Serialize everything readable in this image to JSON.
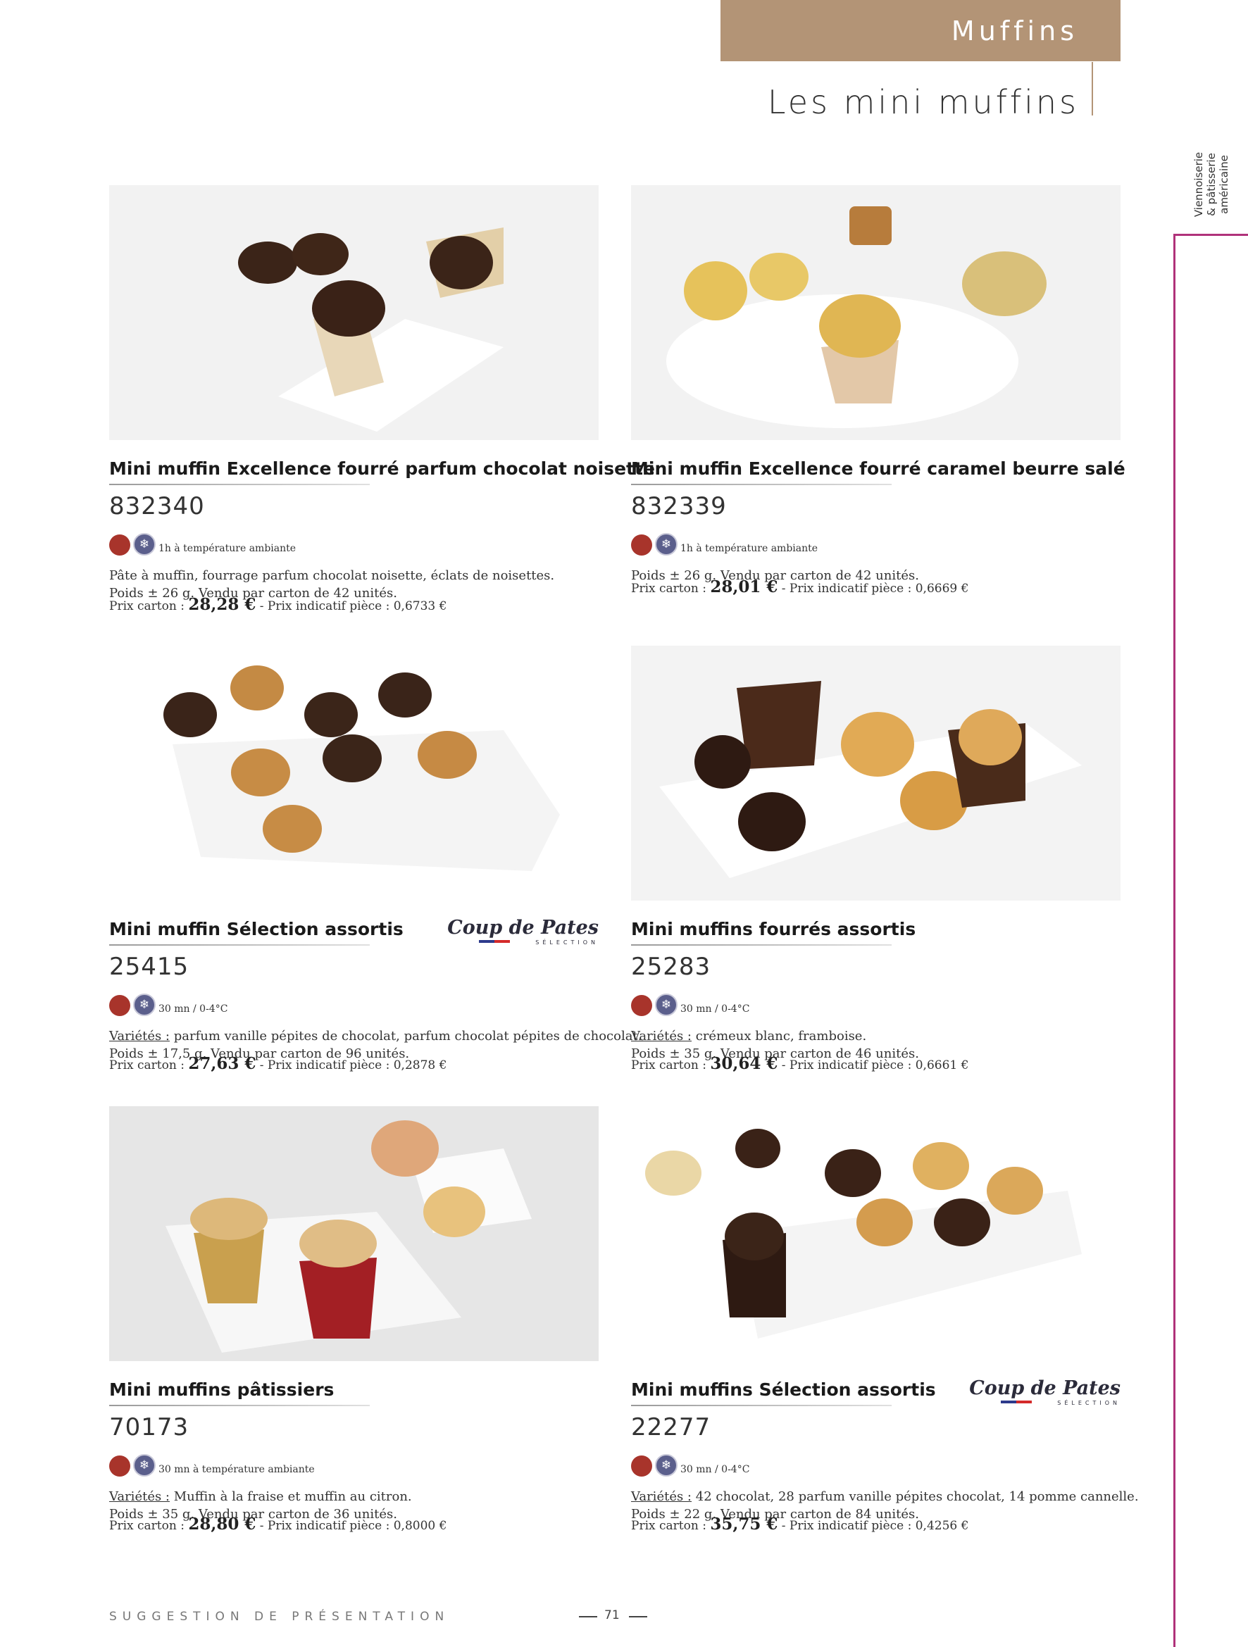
{
  "header": {
    "section": "Muffins",
    "title": "Les mini muffins"
  },
  "side_tab": {
    "line1": "Viennoiserie",
    "line2": "& pâtisserie",
    "line3": "américaine"
  },
  "icons": {
    "color_red": "#a8342b",
    "color_frozen": "#5b5f8c",
    "frozen_icon": "snowflake-icon"
  },
  "products": [
    {
      "name": "Mini muffin Excellence fourré parfum chocolat noisette",
      "code": "832340",
      "storage": "1h à température ambiante",
      "varietes_label": "",
      "desc1": "Pâte à muffin, fourrage parfum chocolat noisette, éclats de noisettes.",
      "desc2": "Poids ± 26 g. Vendu par carton de 42 unités.",
      "price_label": "Prix carton : ",
      "price": "28,28 €",
      "unit_price": " - Prix indicatif pièce : 0,6733 €"
    },
    {
      "name": "Mini muffin Excellence fourré caramel beurre salé",
      "code": "832339",
      "storage": "1h à température ambiante",
      "varietes_label": "",
      "desc1": "Poids ± 26 g. Vendu par carton de 42 unités.",
      "desc2": "",
      "price_label": "Prix carton : ",
      "price": "28,01 €",
      "unit_price": " - Prix indicatif pièce : 0,6669 €"
    },
    {
      "name": "Mini muffin Sélection assortis",
      "code": "25415",
      "storage": "30 mn / 0-4°C",
      "varietes_label": "Variétés :",
      "desc1": " parfum vanille pépites de chocolat, parfum chocolat pépites de chocolat.",
      "desc2": "Poids ± 17,5 g. Vendu par carton de 96 unités.",
      "price_label": "Prix carton : ",
      "price": "27,63 €",
      "unit_price": " - Prix indicatif pièce : 0,2878 €",
      "brand_script": "Coup de Pates",
      "brand_sub": "SÉLECTION"
    },
    {
      "name": "Mini muffins fourrés assortis",
      "code": "25283",
      "storage": "30 mn / 0-4°C",
      "varietes_label": "Variétés :",
      "desc1": " crémeux blanc, framboise.",
      "desc2": "Poids ± 35 g. Vendu par carton de 46 unités.",
      "price_label": "Prix carton : ",
      "price": "30,64 €",
      "unit_price": " - Prix indicatif pièce : 0,6661 €"
    },
    {
      "name": "Mini muffins pâtissiers",
      "code": "70173",
      "storage": "30 mn à température ambiante",
      "varietes_label": "Variétés :",
      "desc1": " Muffin à la fraise et muffin au citron.",
      "desc2": "Poids ± 35 g. Vendu par carton de 36 unités.",
      "price_label": "Prix carton : ",
      "price": "28,80 €",
      "unit_price": " - Prix indicatif pièce : 0,8000 €"
    },
    {
      "name": "Mini muffins Sélection assortis",
      "code": "22277",
      "storage": "30 mn / 0-4°C",
      "varietes_label": "Variétés :",
      "desc1": " 42 chocolat, 28 parfum vanille pépites chocolat, 14 pomme cannelle.",
      "desc2": "Poids ± 22 g. Vendu par carton de 84 unités.",
      "price_label": "Prix carton : ",
      "price": "35,75 €",
      "unit_price": " - Prix indicatif pièce : 0,4256 €",
      "brand_script": "Coup de Pates",
      "brand_sub": "SÉLECTION"
    }
  ],
  "footer": {
    "text": "SUGGESTION DE PRÉSENTATION",
    "page": "71"
  }
}
